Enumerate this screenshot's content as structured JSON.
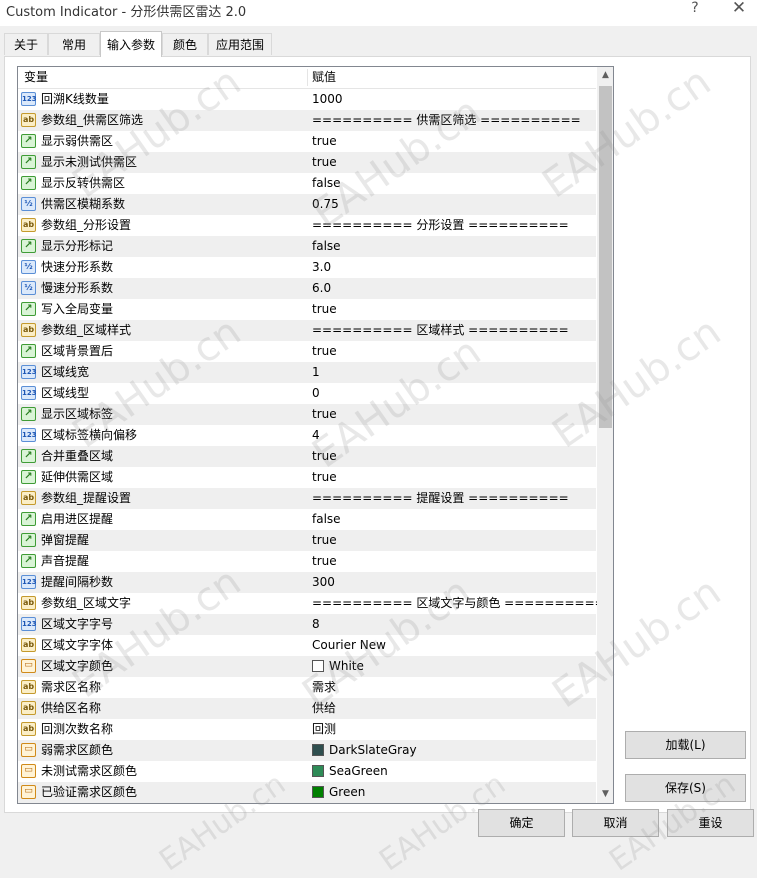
{
  "window": {
    "title": "Custom Indicator - 分形供需区雷达 2.0",
    "help_glyph": "?",
    "close_glyph": "✕"
  },
  "tabs": [
    {
      "label": "关于"
    },
    {
      "label": "常用"
    },
    {
      "label": "输入参数"
    },
    {
      "label": "颜色"
    },
    {
      "label": "应用范围"
    }
  ],
  "grid": {
    "header_variable": "变量",
    "header_value": "赋值",
    "rows": [
      {
        "type": "int",
        "name": "回溯K线数量",
        "value": "1000"
      },
      {
        "type": "string",
        "name": "参数组_供需区筛选",
        "value": "========== 供需区筛选 =========="
      },
      {
        "type": "bool",
        "name": "显示弱供需区",
        "value": "true"
      },
      {
        "type": "bool",
        "name": "显示未测试供需区",
        "value": "true"
      },
      {
        "type": "bool",
        "name": "显示反转供需区",
        "value": "false"
      },
      {
        "type": "double",
        "name": "供需区模糊系数",
        "value": "0.75"
      },
      {
        "type": "string",
        "name": "参数组_分形设置",
        "value": "========== 分形设置 =========="
      },
      {
        "type": "bool",
        "name": "显示分形标记",
        "value": "false"
      },
      {
        "type": "double",
        "name": "快速分形系数",
        "value": "3.0"
      },
      {
        "type": "double",
        "name": "慢速分形系数",
        "value": "6.0"
      },
      {
        "type": "bool",
        "name": "写入全局变量",
        "value": "true"
      },
      {
        "type": "string",
        "name": "参数组_区域样式",
        "value": "========== 区域样式 =========="
      },
      {
        "type": "bool",
        "name": "区域背景置后",
        "value": "true"
      },
      {
        "type": "int",
        "name": "区域线宽",
        "value": "1"
      },
      {
        "type": "int",
        "name": "区域线型",
        "value": "0"
      },
      {
        "type": "bool",
        "name": "显示区域标签",
        "value": "true"
      },
      {
        "type": "int",
        "name": "区域标签横向偏移",
        "value": "4"
      },
      {
        "type": "bool",
        "name": "合并重叠区域",
        "value": "true"
      },
      {
        "type": "bool",
        "name": "延伸供需区域",
        "value": "true"
      },
      {
        "type": "string",
        "name": "参数组_提醒设置",
        "value": "========== 提醒设置 =========="
      },
      {
        "type": "bool",
        "name": "启用进区提醒",
        "value": "false"
      },
      {
        "type": "bool",
        "name": "弹窗提醒",
        "value": "true"
      },
      {
        "type": "bool",
        "name": "声音提醒",
        "value": "true"
      },
      {
        "type": "int",
        "name": "提醒间隔秒数",
        "value": "300"
      },
      {
        "type": "string",
        "name": "参数组_区域文字",
        "value": "========== 区域文字与颜色 =========="
      },
      {
        "type": "int",
        "name": "区域文字字号",
        "value": "8"
      },
      {
        "type": "string",
        "name": "区域文字字体",
        "value": "Courier New"
      },
      {
        "type": "color",
        "name": "区域文字颜色",
        "value": "White",
        "swatch": "#ffffff"
      },
      {
        "type": "string",
        "name": "需求区名称",
        "value": "需求"
      },
      {
        "type": "string",
        "name": "供给区名称",
        "value": "供给"
      },
      {
        "type": "string",
        "name": "回测次数名称",
        "value": "回测"
      },
      {
        "type": "color",
        "name": "弱需求区颜色",
        "value": "DarkSlateGray",
        "swatch": "#2f4f4f"
      },
      {
        "type": "color",
        "name": "未测试需求区颜色",
        "value": "SeaGreen",
        "swatch": "#2e8b57"
      },
      {
        "type": "color",
        "name": "已验证需求区颜色",
        "value": "Green",
        "swatch": "#008000"
      }
    ]
  },
  "icons": {
    "int": "123",
    "string": "ab",
    "bool": "↗",
    "double": "½",
    "color": "▭"
  },
  "buttons": {
    "load": "加载(L)",
    "save": "保存(S)",
    "ok": "确定",
    "cancel": "取消",
    "reset": "重设"
  },
  "watermark": "EAHub.cn"
}
